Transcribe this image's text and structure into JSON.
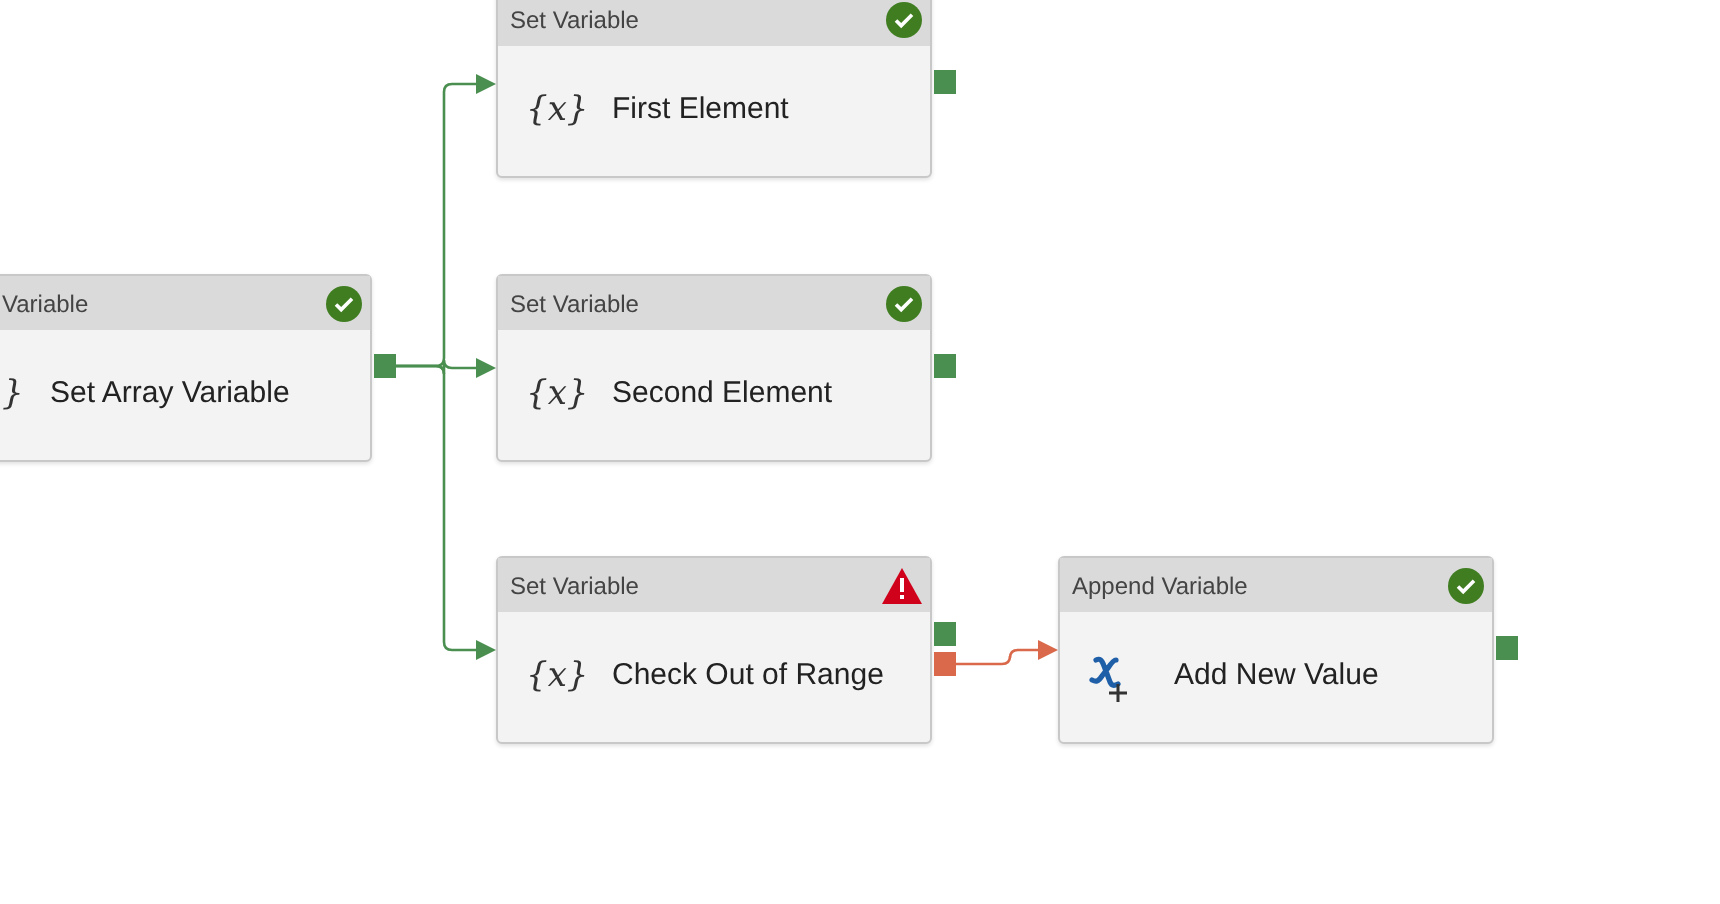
{
  "nodes": [
    {
      "kind": "set",
      "header": "Variable",
      "icon": "}",
      "title": "Set Array Variable",
      "ok": true,
      "cut_left": true,
      "ports": [
        {
          "kind": "success"
        }
      ]
    },
    {
      "kind": "set",
      "header": "Set Variable",
      "icon": "{x}",
      "title": "First Element",
      "ok": true,
      "cut_left": false,
      "ports": [
        {
          "kind": "success"
        }
      ]
    },
    {
      "kind": "set",
      "header": "Set Variable",
      "icon": "{x}",
      "title": "Second Element",
      "ok": true,
      "cut_left": false,
      "ports": [
        {
          "kind": "success"
        }
      ]
    },
    {
      "kind": "set",
      "header": "Set Variable",
      "icon": "{x}",
      "title": "Check Out of Range",
      "ok": false,
      "cut_left": false,
      "ports": [
        {
          "kind": "success"
        },
        {
          "kind": "failure"
        }
      ]
    },
    {
      "kind": "append",
      "header": "Append Variable",
      "title": "Add New Value",
      "ok": true,
      "cut_left": false,
      "ports": [
        {
          "kind": "success"
        }
      ]
    }
  ]
}
